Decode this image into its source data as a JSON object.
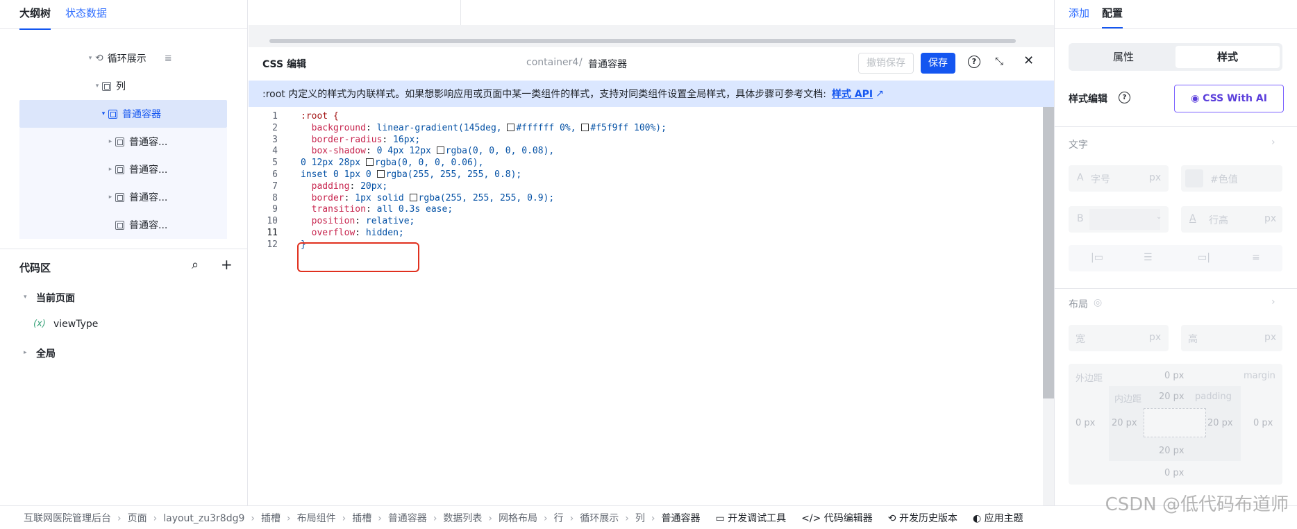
{
  "left_panel": {
    "tabs": [
      "大纲树",
      "状态数据"
    ],
    "tree": [
      {
        "label": "循环展示",
        "icon": "loop-icon",
        "caret": "▾"
      },
      {
        "label": "列",
        "icon": "box-icon",
        "caret": "▾"
      },
      {
        "label": "普通容器",
        "icon": "box-icon",
        "caret": "▾",
        "selected": true
      },
      {
        "label": "普通容...",
        "icon": "box-icon",
        "caret": "▸"
      },
      {
        "label": "普通容...",
        "icon": "box-icon",
        "caret": "▸"
      },
      {
        "label": "普通容...",
        "icon": "box-icon",
        "caret": "▸"
      },
      {
        "label": "普通容...",
        "icon": "box-icon",
        "caret": ""
      }
    ],
    "code_area": {
      "title": "代码区",
      "current_page": "当前页面",
      "variable_prefix": "(x)",
      "variable": "viewType",
      "global": "全局"
    }
  },
  "css_editor": {
    "title": "CSS 编辑",
    "breadcrumb_component": "container4",
    "breadcrumb_sep": "/",
    "breadcrumb_name": "普通容器",
    "undo_label": "撤销保存",
    "save_label": "保存",
    "banner_text": ":root 内定义的样式为内联样式。如果想影响应用或页面中某一类组件的样式，支持对同类组件设置全局样式，具体步骤可参考文档:",
    "banner_link": "样式 API",
    "current_line": 11,
    "lines": [
      ":root {",
      "  background: linear-gradient(145deg, #ffffff 0%, #f5f9ff 100%);",
      "  border-radius: 16px;",
      "  box-shadow: 0 4px 12px rgba(0, 0, 0, 0.08),",
      "0 12px 28px rgba(0, 0, 0, 0.06),",
      "inset 0 1px 0 rgba(255, 255, 255, 0.8);",
      "  padding: 20px;",
      "  border: 1px solid rgba(255, 255, 255, 0.9);",
      "  transition: all 0.3s ease;",
      "  position: relative;",
      "  overflow: hidden;",
      "}"
    ]
  },
  "right_panel": {
    "tabs": [
      "添加",
      "配置"
    ],
    "segment": [
      "属性",
      "样式"
    ],
    "style_edit_label": "样式编辑",
    "css_ai_label": "CSS With AI",
    "text_section": "文字",
    "font_size_placeholder": "字号",
    "px": "px",
    "color_placeholder": "#色值",
    "line_height_placeholder": "行高",
    "layout_section": "布局",
    "width_label": "宽",
    "height_label": "高",
    "margin_label": "外边距",
    "margin_en": "margin",
    "padding_label": "内边距",
    "padding_en": "padding",
    "margin_top": "0 px",
    "margin_left": "0 px",
    "margin_right": "0 px",
    "margin_bottom": "0 px",
    "padding_top": "20 px",
    "padding_left": "20 px",
    "padding_right": "20 px",
    "padding_bottom": "20 px"
  },
  "bottom_bar": {
    "breadcrumbs": [
      "互联网医院管理后台",
      "页面",
      "layout_zu3r8dg9",
      "插槽",
      "布局组件",
      "插槽",
      "普通容器",
      "数据列表",
      "网格布局",
      "行",
      "循环展示",
      "列",
      "普通容器"
    ],
    "tools": [
      "开发调试工具",
      "代码编辑器",
      "开发历史版本",
      "应用主题"
    ]
  },
  "watermark": "CSDN @低代码布道师",
  "colors": {
    "accent": "#1456f0",
    "highlight_border": "#e0301e",
    "banner_bg": "#dbe7ff"
  }
}
